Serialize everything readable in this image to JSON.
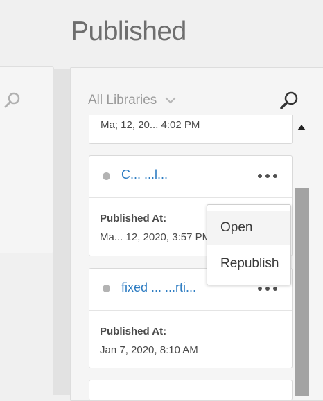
{
  "header": {
    "title": "Published"
  },
  "filter": {
    "label": "All Libraries"
  },
  "cards": [
    {
      "timestamp": "Ma; 12, 20... 4:02 PM"
    },
    {
      "title": "C...   ...l...",
      "published_label": "Published At:",
      "published_value": "Ma... 12, 2020, 3:57 PM"
    },
    {
      "title": "fixed ...   ...rti...",
      "published_label": "Published At:",
      "published_value": "Jan 7, 2020, 8:10 AM"
    }
  ],
  "context_menu": {
    "items": [
      {
        "label": "Open"
      },
      {
        "label": "Republish"
      }
    ]
  },
  "icons": {
    "search": "search-icon",
    "chevron": "chevron-down-icon",
    "more": "more-icon",
    "scroll_up": "triangle-up-icon"
  },
  "colors": {
    "title_link": "#2d7cc2",
    "scrollbar_thumb": "#a3a3a3",
    "status_dot": "#b3b3b3"
  }
}
